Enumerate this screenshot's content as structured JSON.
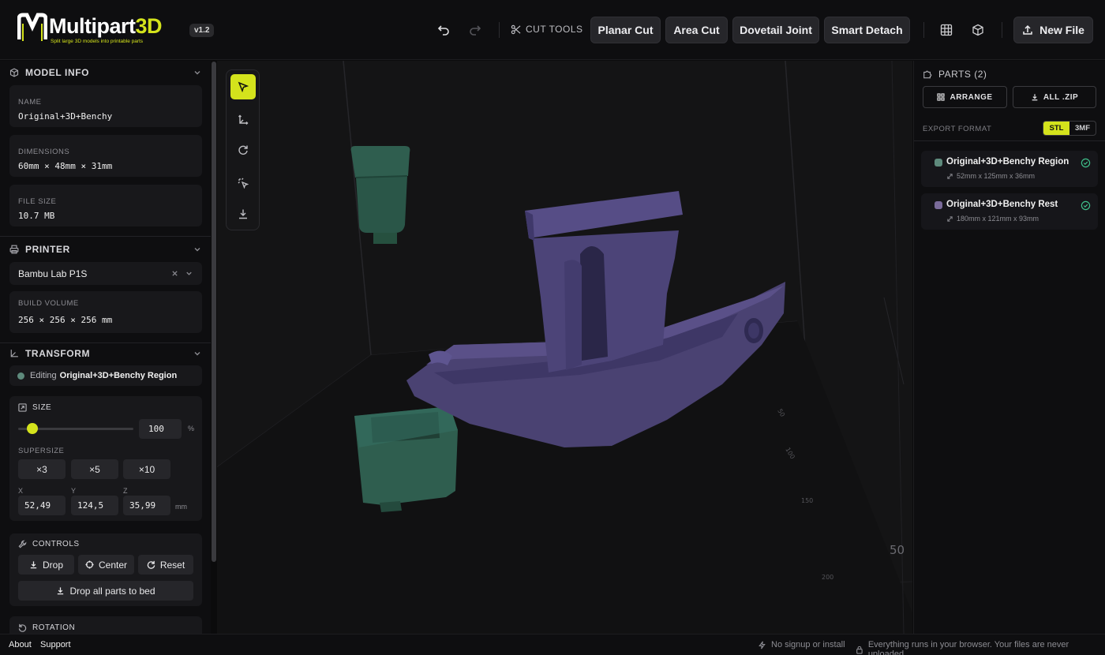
{
  "header": {
    "logo_text_main": "Multipart",
    "logo_text_accent": "3D",
    "logo_tagline": "Split large 3D models into printable parts",
    "version": "v1.2",
    "cut_tools_label": "CUT TOOLS",
    "buttons": [
      "Planar Cut",
      "Area Cut",
      "Dovetail Joint",
      "Smart Detach"
    ],
    "new_file_label": "New File"
  },
  "sidebar": {
    "model_info": {
      "title": "MODEL INFO",
      "name_label": "NAME",
      "name_value": "Original+3D+Benchy",
      "dimensions_label": "DIMENSIONS",
      "dimensions_value": "60mm × 48mm × 31mm",
      "file_size_label": "FILE SIZE",
      "file_size_value": "10.7 MB"
    },
    "printer": {
      "title": "PRINTER",
      "selected": "Bambu Lab P1S",
      "build_volume_label": "BUILD VOLUME",
      "build_volume_value": "256 × 256 × 256 mm"
    },
    "transform": {
      "title": "TRANSFORM",
      "editing_prefix": "Editing",
      "editing_target": "Original+3D+Benchy Region",
      "size_label": "SIZE",
      "size_value": "100",
      "size_unit": "%",
      "size_slider_fraction": 0.12,
      "supersize_label": "SUPERSIZE",
      "supersize_options": [
        "×3",
        "×5",
        "×10"
      ],
      "axis_labels": [
        "X",
        "Y",
        "Z"
      ],
      "x_value": "52,49",
      "y_value": "124,5",
      "z_value": "35,99",
      "unit": "mm"
    },
    "controls": {
      "title": "CONTROLS",
      "drop_label": "Drop",
      "center_label": "Center",
      "reset_label": "Reset",
      "drop_all_label": "Drop all parts to bed"
    },
    "rotation": {
      "title": "ROTATION"
    }
  },
  "viewport": {
    "axis_ticks": [
      "50",
      "100",
      "150",
      "200"
    ],
    "big_label": "50"
  },
  "parts_panel": {
    "title": "PARTS (2)",
    "arrange_label": "ARRANGE",
    "zip_label": "ALL .ZIP",
    "export_format_label": "EXPORT FORMAT",
    "formats": [
      "STL",
      "3MF"
    ],
    "selected_format": "STL",
    "parts": [
      {
        "name": "Original+3D+Benchy Region",
        "dims": "52mm x 125mm x 36mm",
        "color": "#5e8a7c"
      },
      {
        "name": "Original+3D+Benchy Rest",
        "dims": "180mm x 121mm x 93mm",
        "color": "#7a6b9a"
      }
    ]
  },
  "footer": {
    "about": "About",
    "support": "Support",
    "no_signup": "No signup or install",
    "privacy": "Everything runs in your browser. Your files are never uploaded."
  },
  "colors": {
    "accent": "#d4e31c",
    "boat": "#4a4272",
    "region_part": "#2f5e4f"
  }
}
